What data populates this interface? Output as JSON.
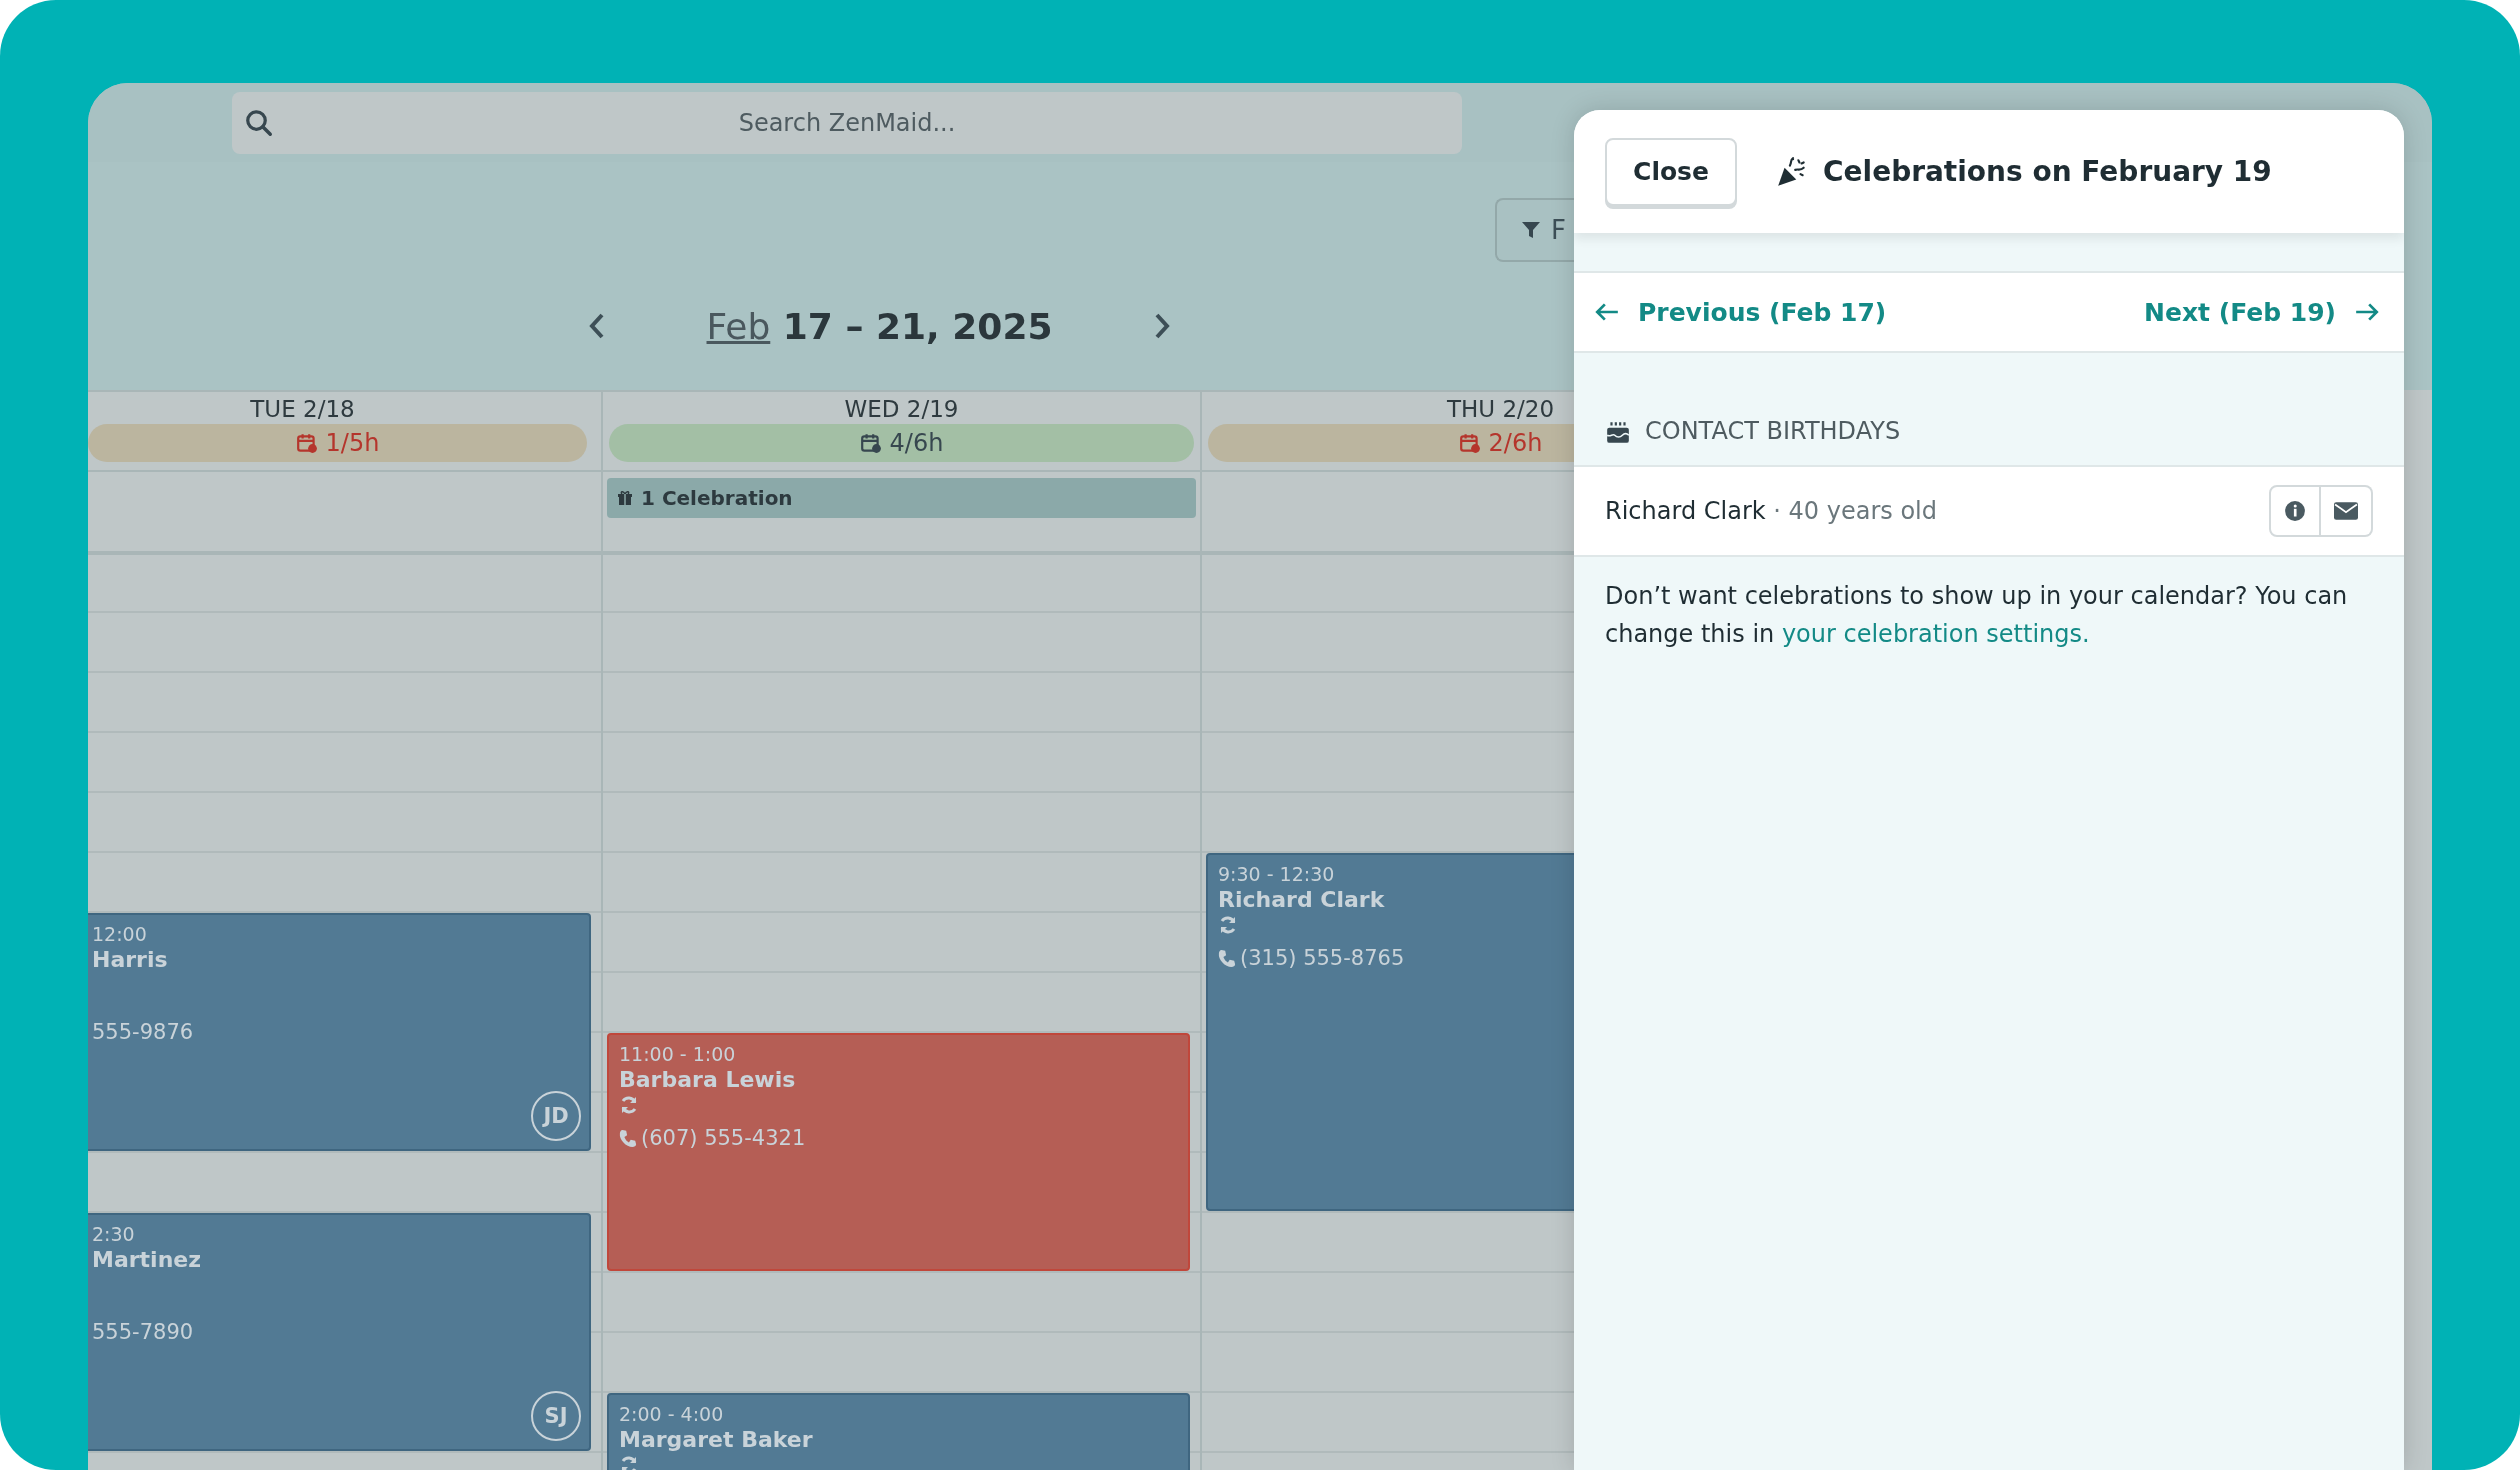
{
  "search": {
    "placeholder": "Search ZenMaid..."
  },
  "filter_button": {
    "label": "F"
  },
  "date_nav": {
    "month": "Feb",
    "range": "17 – 21, 2025"
  },
  "days": [
    {
      "label": "TUE 2/18",
      "hours": "1/5h",
      "color": "#bbb59f",
      "events": [
        {
          "kind": "clipped",
          "time": "12:00",
          "name": "Harris",
          "phone": "555-9876",
          "avatar": "JD",
          "color": "#527a94"
        },
        {
          "kind": "clipped",
          "time": "2:30",
          "name": "Martinez",
          "phone": "555-7890",
          "avatar": "SJ",
          "color": "#527a94"
        }
      ]
    },
    {
      "label": "WED 2/19",
      "hours": "4/6h",
      "color": "#a3bfa5",
      "celebration": "1 Celebration",
      "events": [
        {
          "kind": "full",
          "time": "11:00 - 1:00",
          "name": "Barbara Lewis",
          "phone": "(607) 555-4321",
          "recurring": true,
          "color": "#b55e55"
        },
        {
          "kind": "full",
          "time": "2:00 - 4:00",
          "name": "Margaret Baker",
          "recurring": true,
          "color": "#527a94"
        }
      ]
    },
    {
      "label": "THU 2/20",
      "hours": "2/6h",
      "color": "#bbb59f",
      "events": [
        {
          "kind": "full",
          "time": "9:30 - 12:30",
          "name": "Richard Clark",
          "phone": "(315) 555-8765",
          "recurring": true,
          "color": "#527a94"
        }
      ]
    }
  ],
  "panel": {
    "close": "Close",
    "title": "Celebrations on February 19",
    "previous": "Previous (Feb 17)",
    "next": "Next (Feb 19)",
    "section": "CONTACT BIRTHDAYS",
    "contacts": [
      {
        "name": "Richard Clark",
        "detail": "· 40 years old"
      }
    ],
    "note": {
      "text": "Don’t want celebrations to show up in your calendar? You can change this in ",
      "link": "your celebration settings."
    }
  }
}
